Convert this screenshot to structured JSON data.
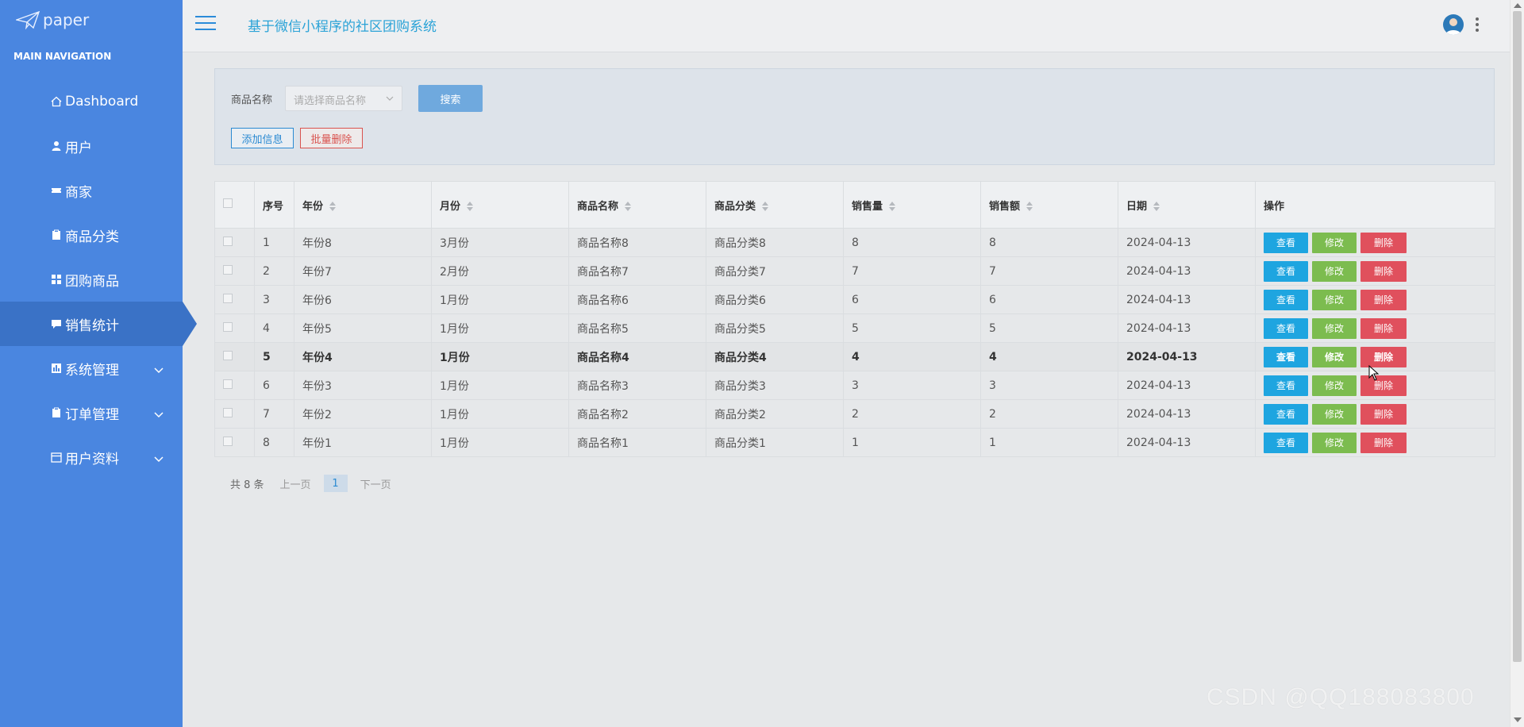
{
  "app": {
    "logo_text": "paper",
    "title": "基于微信小程序的社区团购系统"
  },
  "sidebar": {
    "section_title": "MAIN NAVIGATION",
    "items": [
      {
        "label": "Dashboard",
        "icon": "home-icon"
      },
      {
        "label": "用户",
        "icon": "user-icon"
      },
      {
        "label": "商家",
        "icon": "ticket-icon"
      },
      {
        "label": "商品分类",
        "icon": "clipboard-icon"
      },
      {
        "label": "团购商品",
        "icon": "grid-icon"
      },
      {
        "label": "销售统计",
        "icon": "comment-icon",
        "active": true
      },
      {
        "label": "系统管理",
        "icon": "chart-icon",
        "expandable": true
      },
      {
        "label": "订单管理",
        "icon": "clipboard-icon",
        "expandable": true
      },
      {
        "label": "用户资料",
        "icon": "calendar-icon",
        "expandable": true
      }
    ]
  },
  "search": {
    "label": "商品名称",
    "placeholder": "请选择商品名称",
    "search_button": "搜索",
    "add_button": "添加信息",
    "batch_delete_button": "批量删除"
  },
  "table": {
    "columns": [
      "序号",
      "年份",
      "月份",
      "商品名称",
      "商品分类",
      "销售量",
      "销售额",
      "日期",
      "操作"
    ],
    "actions": {
      "view": "查看",
      "edit": "修改",
      "delete": "删除"
    },
    "rows": [
      {
        "no": "1",
        "year": "年份8",
        "month": "3月份",
        "name": "商品名称8",
        "category": "商品分类8",
        "qty": "8",
        "amount": "8",
        "date": "2024-04-13"
      },
      {
        "no": "2",
        "year": "年份7",
        "month": "2月份",
        "name": "商品名称7",
        "category": "商品分类7",
        "qty": "7",
        "amount": "7",
        "date": "2024-04-13"
      },
      {
        "no": "3",
        "year": "年份6",
        "month": "1月份",
        "name": "商品名称6",
        "category": "商品分类6",
        "qty": "6",
        "amount": "6",
        "date": "2024-04-13"
      },
      {
        "no": "4",
        "year": "年份5",
        "month": "1月份",
        "name": "商品名称5",
        "category": "商品分类5",
        "qty": "5",
        "amount": "5",
        "date": "2024-04-13"
      },
      {
        "no": "5",
        "year": "年份4",
        "month": "1月份",
        "name": "商品名称4",
        "category": "商品分类4",
        "qty": "4",
        "amount": "4",
        "date": "2024-04-13"
      },
      {
        "no": "6",
        "year": "年份3",
        "month": "1月份",
        "name": "商品名称3",
        "category": "商品分类3",
        "qty": "3",
        "amount": "3",
        "date": "2024-04-13"
      },
      {
        "no": "7",
        "year": "年份2",
        "month": "1月份",
        "name": "商品名称2",
        "category": "商品分类2",
        "qty": "2",
        "amount": "2",
        "date": "2024-04-13"
      },
      {
        "no": "8",
        "year": "年份1",
        "month": "1月份",
        "name": "商品名称1",
        "category": "商品分类1",
        "qty": "1",
        "amount": "1",
        "date": "2024-04-13"
      }
    ]
  },
  "pagination": {
    "total": "共 8 条",
    "prev": "上一页",
    "current": "1",
    "next": "下一页"
  },
  "watermark": "CSDN @QQ188083800",
  "colors": {
    "sidebar": "#4a86e0",
    "sidebar_active": "#3a72c6",
    "title": "#2ba3d7",
    "view": "#1ea5e0",
    "edit": "#7cbc4f",
    "delete": "#e0505d"
  }
}
